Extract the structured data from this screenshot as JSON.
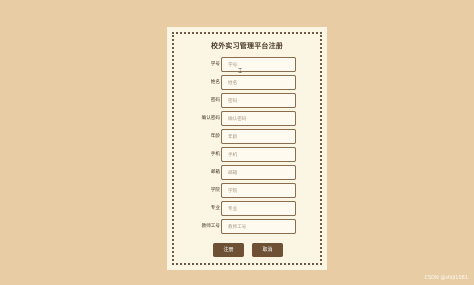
{
  "form": {
    "title": "校外实习管理平台注册",
    "fields": [
      {
        "label": "学号",
        "placeholder": "学号"
      },
      {
        "label": "姓名",
        "placeholder": "姓名"
      },
      {
        "label": "密码",
        "placeholder": "密码"
      },
      {
        "label": "确认密码",
        "placeholder": "确认密码"
      },
      {
        "label": "年龄",
        "placeholder": "年龄"
      },
      {
        "label": "手机",
        "placeholder": "手机"
      },
      {
        "label": "邮箱",
        "placeholder": "邮箱"
      },
      {
        "label": "学院",
        "placeholder": "学院"
      },
      {
        "label": "专业",
        "placeholder": "专业"
      },
      {
        "label": "教师工号",
        "placeholder": "教师工号"
      }
    ],
    "buttons": {
      "register": "注册",
      "cancel": "取消"
    }
  },
  "watermark": "CSDN @shiji1081",
  "colors": {
    "background": "#e8cca3",
    "card": "#fbf5e3",
    "accent": "#6e5134"
  }
}
